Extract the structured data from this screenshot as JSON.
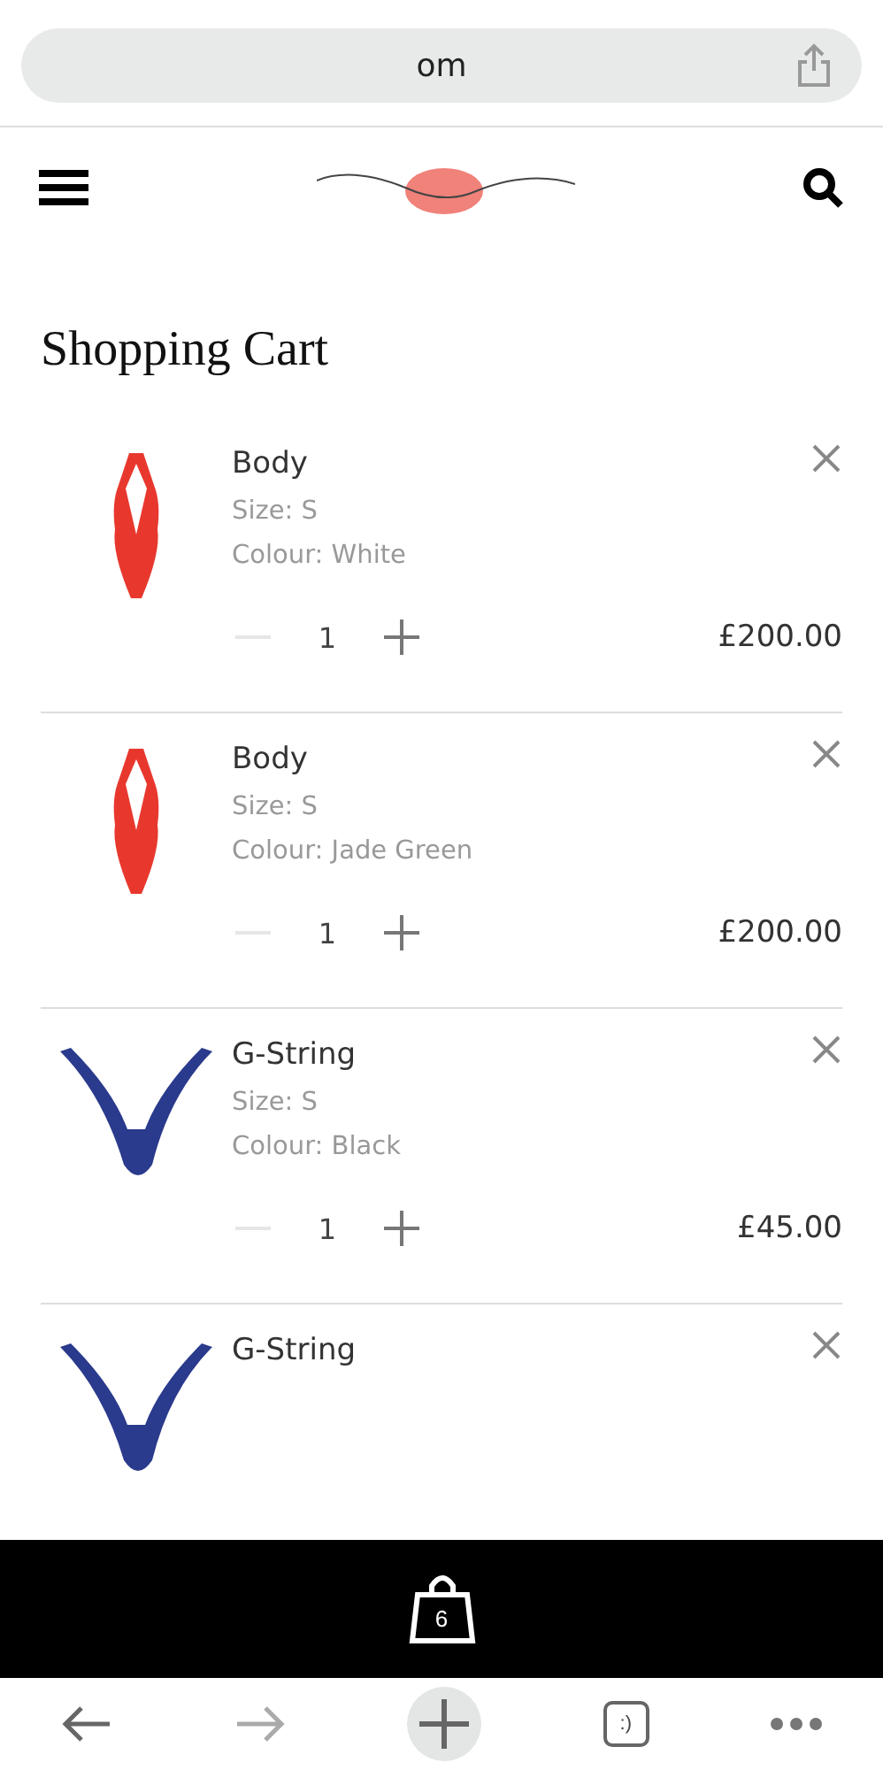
{
  "browser": {
    "url": "om"
  },
  "page": {
    "title": "Shopping Cart"
  },
  "cart_items": [
    {
      "kind": "body",
      "name": "Body",
      "size": "Size: S",
      "colour": "Colour: White",
      "quantity": "1",
      "decrease_disabled": true,
      "price": "£200.00"
    },
    {
      "kind": "body",
      "name": "Body",
      "size": "Size: S",
      "colour": "Colour: Jade Green",
      "quantity": "1",
      "decrease_disabled": true,
      "price": "£200.00"
    },
    {
      "kind": "gstring",
      "name": "G-String",
      "size": "Size: S",
      "colour": "Colour: Black",
      "quantity": "1",
      "decrease_disabled": true,
      "price": "£45.00"
    },
    {
      "kind": "gstring",
      "name": "G-String"
    }
  ],
  "cart_bar": {
    "count": "6"
  },
  "toolbar": {
    "tabs_label": ":)"
  }
}
